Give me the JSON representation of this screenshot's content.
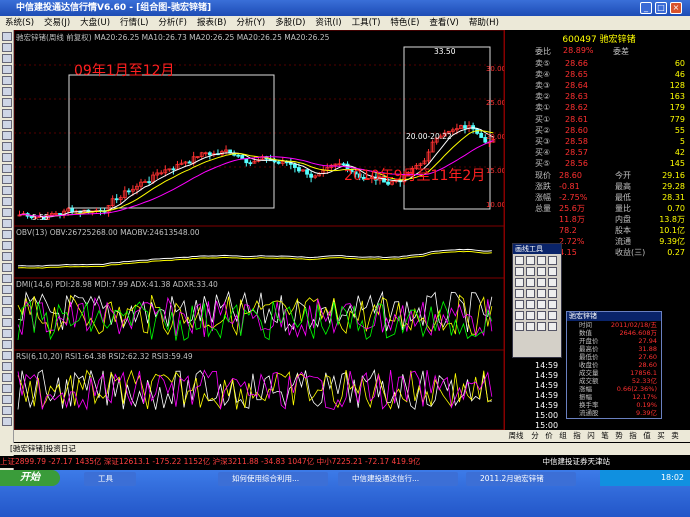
{
  "window": {
    "title": "中信建投通达信行情V6.60 - [组合图-驰宏锌锗]"
  },
  "menu": [
    "系统(S)",
    "交易(J)",
    "大盘(U)",
    "行情(L)",
    "分析(F)",
    "报表(B)",
    "分析(Y)",
    "多股(D)",
    "资讯(I)",
    "工具(T)",
    "特色(E)",
    "查看(V)",
    "帮助(H)"
  ],
  "chart": {
    "header": "驰宏锌锗(周线 前复权) MA20:26.25 MA10:26.73 MA20:26.25 MA20:26.25 MA20:26.25",
    "annotations": {
      "a1": "09年1月至12月",
      "a2": "2010年9月至11年2月",
      "high": "33.50",
      "low": "5.55",
      "range": "20.00-20.22"
    },
    "yaxis": [
      "30.00",
      "25.00",
      "20.00",
      "15.00",
      "10.00"
    ],
    "obv": "OBV(13) OBV:26725268.00 MAOBV:24613548.00",
    "dmi": "DMI(14,6) PDI:28.98 MDI:7.99 ADX:41.38 ADXR:33.40",
    "rsi": "RSI(6,10,20) RSI1:64.38 RSI2:62.32 RSI3:59.49"
  },
  "quote": {
    "code": "600497 驰宏锌锗",
    "weibi": {
      "label": "委比",
      "pct": "28.89%",
      "label2": "委差"
    },
    "sells": [
      {
        "l": "卖⑤",
        "p": "28.66",
        "v": "60"
      },
      {
        "l": "卖④",
        "p": "28.65",
        "v": "46"
      },
      {
        "l": "卖③",
        "p": "28.64",
        "v": "128"
      },
      {
        "l": "卖②",
        "p": "28.63",
        "v": "163"
      },
      {
        "l": "卖①",
        "p": "28.62",
        "v": "179"
      }
    ],
    "buys": [
      {
        "l": "买①",
        "p": "28.61",
        "v": "779"
      },
      {
        "l": "买②",
        "p": "28.60",
        "v": "55"
      },
      {
        "l": "买③",
        "p": "28.58",
        "v": "5"
      },
      {
        "l": "买④",
        "p": "28.57",
        "v": "42"
      },
      {
        "l": "买⑤",
        "p": "28.56",
        "v": "145"
      }
    ],
    "stats": [
      [
        "现价",
        "28.60",
        "今开",
        "29.16"
      ],
      [
        "涨跌",
        "-0.81",
        "最高",
        "29.28"
      ],
      [
        "涨幅",
        "-2.75%",
        "最低",
        "28.31"
      ],
      [
        "总量",
        "25.6万",
        "量比",
        "0.70"
      ],
      [
        "",
        "11.8万",
        "内盘",
        "13.8万"
      ],
      [
        "",
        "78.2",
        "股本",
        "10.1亿"
      ],
      [
        "",
        "2.72%",
        "流通",
        "9.39亿"
      ],
      [
        "",
        "4.15",
        "收益(三)",
        "0.27"
      ]
    ],
    "ticks": [
      "14:59",
      "14:59",
      "14:59",
      "14:59",
      "14:59",
      "15:00",
      "15:00",
      "15:00"
    ]
  },
  "drawtools": {
    "title": "画线工具"
  },
  "infobox": {
    "title": "驰宏锌锗",
    "rows": [
      [
        "时间",
        "2011/02/18/五"
      ],
      [
        "数值",
        "2646.608万"
      ],
      [
        "开盘价",
        "27.94"
      ],
      [
        "最高价",
        "31.88"
      ],
      [
        "最低价",
        "27.60"
      ],
      [
        "收盘价",
        "28.60"
      ],
      [
        "成交量",
        "17856.1"
      ],
      [
        "成交额",
        "52.33亿"
      ],
      [
        "涨幅",
        "0.66(2.36%)"
      ],
      [
        "振幅",
        "12.17%"
      ],
      [
        "换手率",
        "0.19%"
      ],
      [
        "流通股",
        "9.39亿"
      ]
    ]
  },
  "bottom": {
    "tabs": [
      "周线",
      "分",
      "价",
      "组",
      "指",
      "闪",
      "笔",
      "势",
      "指",
      "值",
      "买",
      "卖",
      "财",
      "值",
      "批",
      "操"
    ],
    "right": [
      "切换",
      "横竖",
      "综合",
      "打开",
      "资讯"
    ]
  },
  "ticker": "上证2899.79  -27.17  1435亿  深证12613.1  -175.22 1152亿  沪深3211.88  -34.83  1047亿  中小7225.21  -72.17  419.9亿",
  "ticker_right": "中信建投证券天津站",
  "diary": "[驰宏锌锗]投资日记",
  "taskbar": {
    "start": "开始",
    "items": [
      "工具",
      "如何使用综合利用...",
      "中信建投通达信行...",
      "2011.2月驰宏锌锗"
    ],
    "clock": "18:02"
  }
}
